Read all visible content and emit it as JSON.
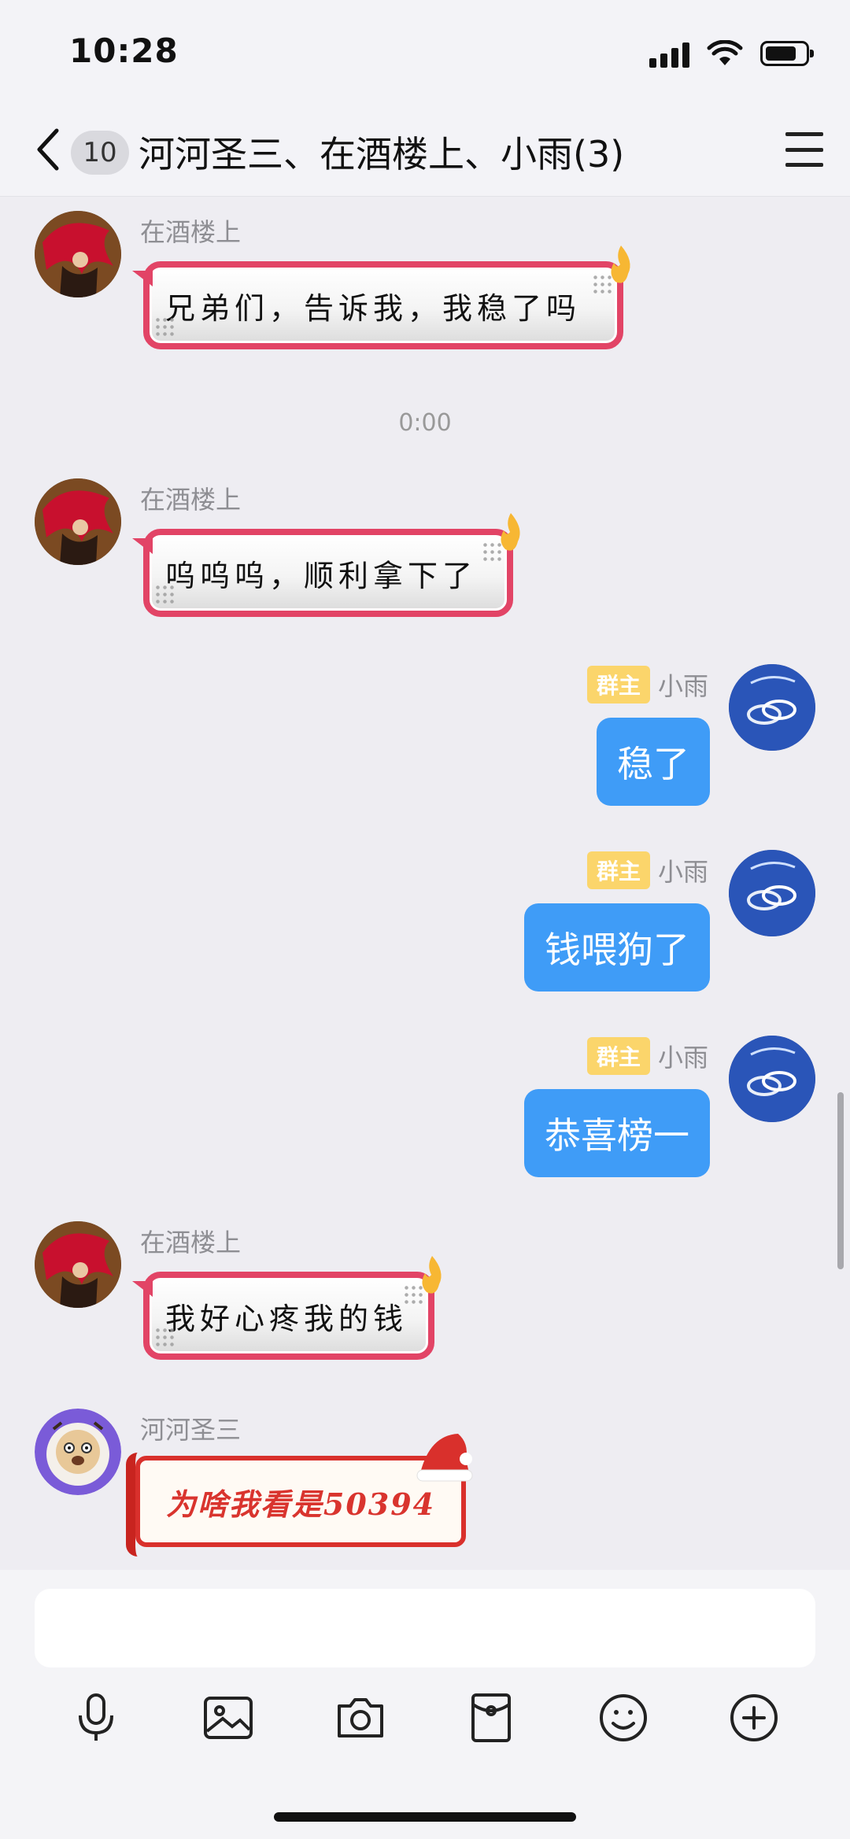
{
  "status_bar": {
    "time": "10:28"
  },
  "header": {
    "unread_count": "10",
    "title": "河河圣三、在酒楼上、小雨(3)"
  },
  "messages": [
    {
      "sender": "在酒楼上",
      "text": "兄弟们，告诉我，我稳了吗"
    },
    {
      "timestamp": "0:00"
    },
    {
      "sender": "在酒楼上",
      "text": "呜呜呜，顺利拿下了"
    },
    {
      "sender": "小雨",
      "badge": "群主",
      "text": "稳了"
    },
    {
      "sender": "小雨",
      "badge": "群主",
      "text": "钱喂狗了"
    },
    {
      "sender": "小雨",
      "badge": "群主",
      "text": "恭喜榜一"
    },
    {
      "sender": "在酒楼上",
      "text": "我好心疼我的钱"
    },
    {
      "sender": "河河圣三",
      "text": "为啥我看是50394"
    }
  ],
  "input": {
    "placeholder": ""
  },
  "toolbar": {
    "icons": [
      "microphone-icon",
      "image-icon",
      "camera-icon",
      "red-packet-icon",
      "emoji-icon",
      "plus-icon"
    ]
  },
  "colors": {
    "blue_bubble": "#3f9cf7",
    "fancy_border": "#e24466",
    "owner_badge": "#fbd56b",
    "xmas_red": "#d9302c"
  }
}
